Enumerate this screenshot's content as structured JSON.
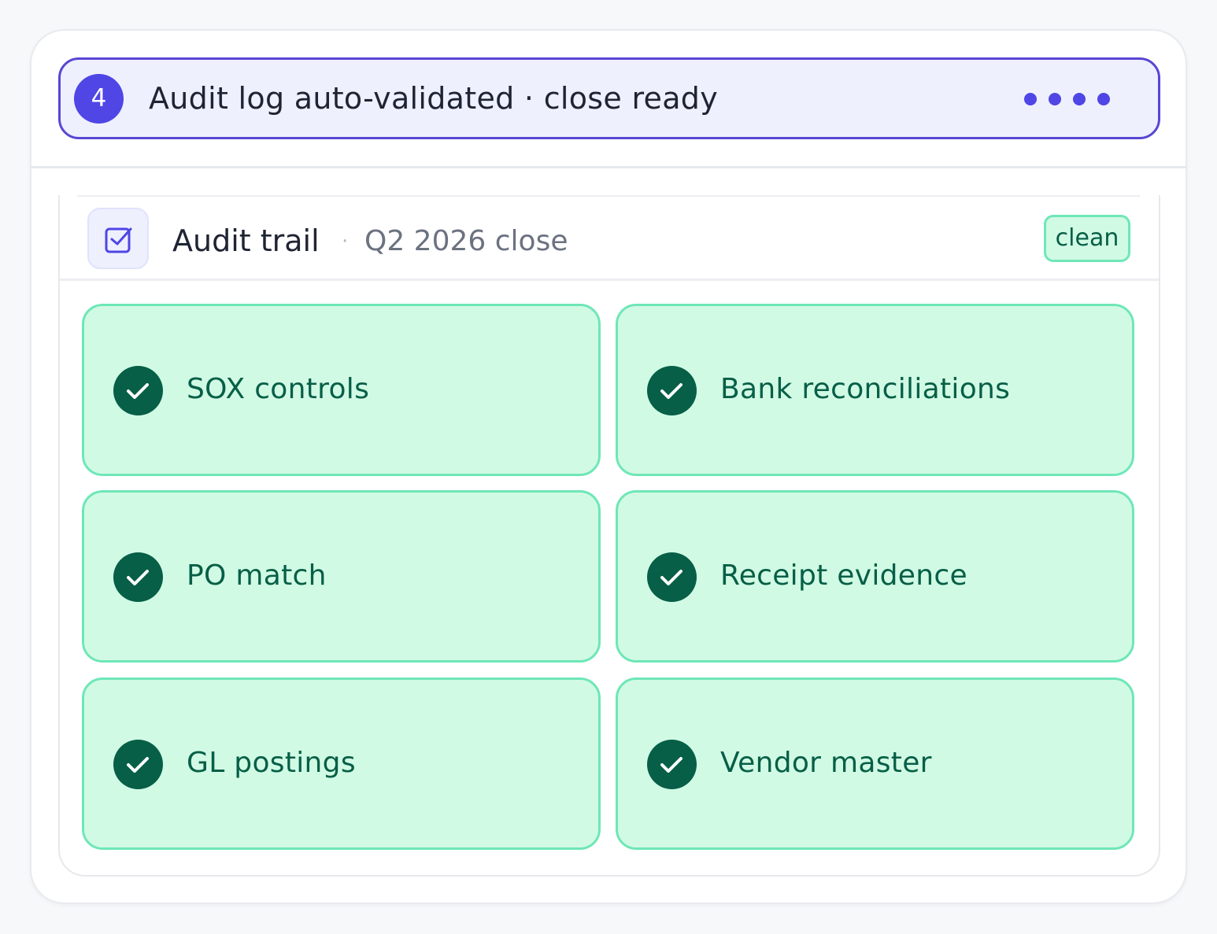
{
  "step": {
    "number": "4",
    "text": "Audit log auto-validated · close ready",
    "progress_dots": 4,
    "accent_color": "#4f46e5"
  },
  "trail": {
    "icon": "checkbox-icon",
    "title": "Audit trail",
    "separator": "·",
    "subtitle": "Q2 2026 close",
    "badge": "clean"
  },
  "items": [
    {
      "label": "SOX controls",
      "icon": "check-circle-icon"
    },
    {
      "label": "Bank reconciliations",
      "icon": "check-circle-icon"
    },
    {
      "label": "PO match",
      "icon": "check-circle-icon"
    },
    {
      "label": "Receipt evidence",
      "icon": "check-circle-icon"
    },
    {
      "label": "GL postings",
      "icon": "check-circle-icon"
    },
    {
      "label": "Vendor master",
      "icon": "check-circle-icon"
    }
  ],
  "colors": {
    "success_bg": "#d1fae5",
    "success_border": "#6ee7b7",
    "success_text": "#065f46"
  }
}
